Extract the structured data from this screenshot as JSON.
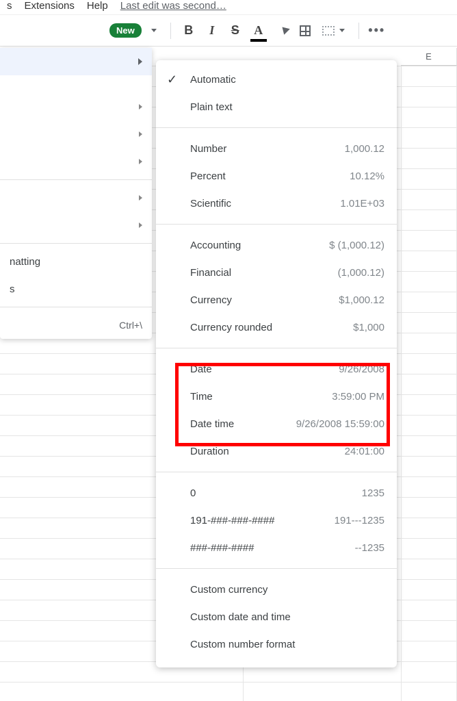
{
  "menubar": {
    "items": [
      "s",
      "Extensions",
      "Help"
    ],
    "edit_status": "Last edit was second…"
  },
  "toolbar": {
    "new_label": "New"
  },
  "format_menu": {
    "items_with_arrow_count": 6,
    "item_formatting": "natting",
    "item_clear_suffix": "s",
    "shortcut_clear": "Ctrl+\\"
  },
  "number_menu": {
    "automatic": "Automatic",
    "plain_text": "Plain text",
    "number": {
      "label": "Number",
      "sample": "1,000.12"
    },
    "percent": {
      "label": "Percent",
      "sample": "10.12%"
    },
    "scientific": {
      "label": "Scientific",
      "sample": "1.01E+03"
    },
    "accounting": {
      "label": "Accounting",
      "sample": "$ (1,000.12)"
    },
    "financial": {
      "label": "Financial",
      "sample": "(1,000.12)"
    },
    "currency": {
      "label": "Currency",
      "sample": "$1,000.12"
    },
    "currency_rounded": {
      "label": "Currency rounded",
      "sample": "$1,000"
    },
    "date": {
      "label": "Date",
      "sample": "9/26/2008"
    },
    "time": {
      "label": "Time",
      "sample": "3:59:00 PM"
    },
    "datetime": {
      "label": "Date time",
      "sample": "9/26/2008 15:59:00"
    },
    "duration": {
      "label": "Duration",
      "sample": "24:01:00"
    },
    "custom0": {
      "label": "0",
      "sample": "1235"
    },
    "custom1": {
      "label": "191-###-###-####",
      "sample": "191---1235"
    },
    "custom2": {
      "label": "###-###-####",
      "sample": "--1235"
    },
    "custom_currency": "Custom currency",
    "custom_datetime": "Custom date and time",
    "custom_number": "Custom number format"
  },
  "grid": {
    "col_e": "E"
  }
}
